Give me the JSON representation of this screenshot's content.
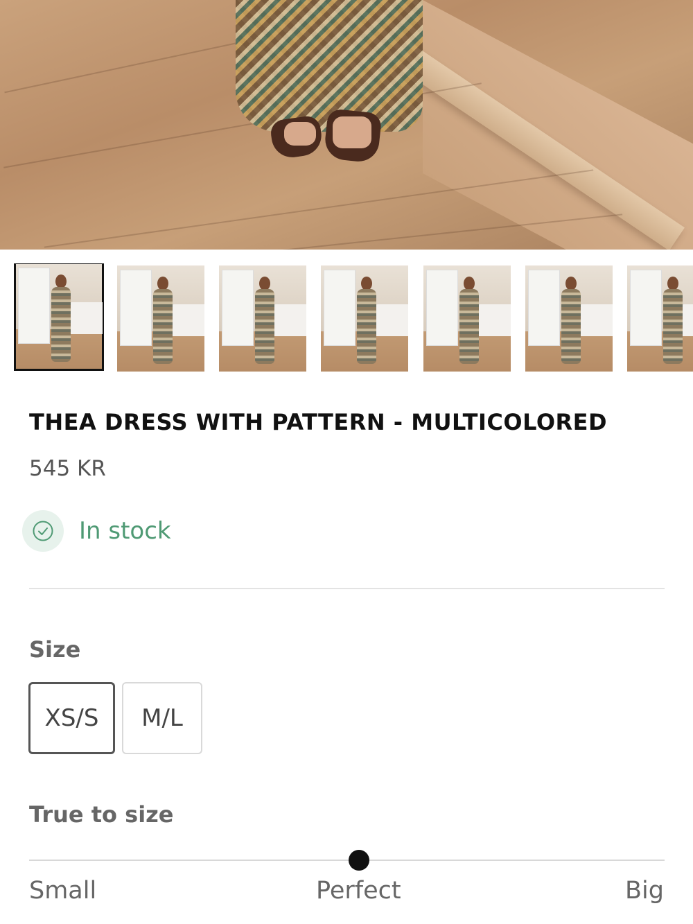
{
  "product": {
    "title": "THEA DRESS WITH PATTERN - MULTICOLORED",
    "price": "545 KR",
    "stock_status": "In stock",
    "colors": {
      "stock_green": "#4f9a74",
      "stock_badge_bg": "#e7f2ec",
      "text_dark": "#111111",
      "text_muted": "#555555"
    }
  },
  "gallery": {
    "main_image": "dress-photo-floor",
    "thumbnails": [
      {
        "id": "thumb-1",
        "selected": true
      },
      {
        "id": "thumb-2",
        "selected": false
      },
      {
        "id": "thumb-3",
        "selected": false
      },
      {
        "id": "thumb-4",
        "selected": false
      },
      {
        "id": "thumb-5",
        "selected": false
      },
      {
        "id": "thumb-6",
        "selected": false
      },
      {
        "id": "thumb-7",
        "selected": false
      }
    ]
  },
  "size": {
    "heading": "Size",
    "options": [
      {
        "label": "XS/S",
        "selected": true
      },
      {
        "label": "M/L",
        "selected": false
      }
    ]
  },
  "fit": {
    "heading": "True to size",
    "labels": {
      "small": "Small",
      "perfect": "Perfect",
      "big": "Big"
    },
    "value": 0.5
  },
  "icons": {
    "stock": "check-circle-icon"
  }
}
